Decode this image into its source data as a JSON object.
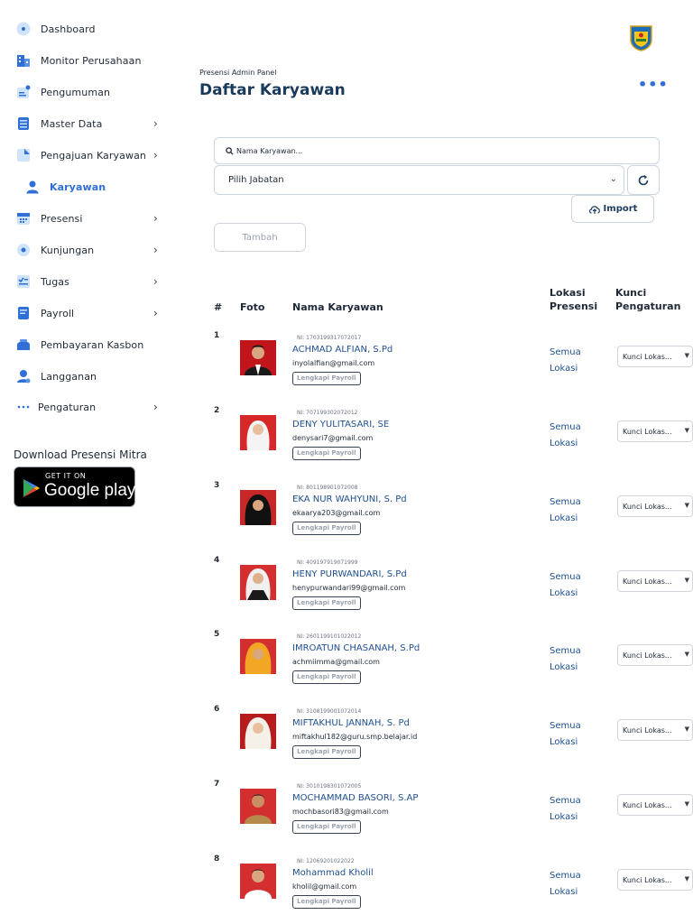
{
  "sidebar": {
    "items": [
      {
        "label": "Dashboard",
        "icon": "home-icon",
        "chevron": ""
      },
      {
        "label": "Monitor Perusahaan",
        "icon": "building-icon",
        "chevron": ""
      },
      {
        "label": "Pengumuman",
        "icon": "announcement-icon",
        "chevron": ""
      },
      {
        "label": "Master Data",
        "icon": "database-icon",
        "chevron": "›"
      },
      {
        "label": "Pengajuan Karyawan",
        "icon": "document-icon",
        "chevron": "›"
      },
      {
        "label": "Karyawan",
        "icon": "user-icon",
        "chevron": ""
      },
      {
        "label": "Presensi",
        "icon": "calendar-icon",
        "chevron": "›"
      },
      {
        "label": "Kunjungan",
        "icon": "location-icon",
        "chevron": "›"
      },
      {
        "label": "Tugas",
        "icon": "task-icon",
        "chevron": "›"
      },
      {
        "label": "Payroll",
        "icon": "payroll-icon",
        "chevron": "›"
      },
      {
        "label": "Pembayaran Kasbon",
        "icon": "wallet-icon",
        "chevron": ""
      },
      {
        "label": "Langganan",
        "icon": "subscription-icon",
        "chevron": ""
      },
      {
        "label": "Pengaturan",
        "icon": "more-dots-icon",
        "chevron": "›"
      }
    ],
    "download_title": "Download Presensi Mitra",
    "gplay_top": "GET IT ON",
    "gplay_bottom": "Google play"
  },
  "header": {
    "breadcrumb": "Presensi Admin Panel",
    "title": "Daftar Karyawan",
    "more": "•••"
  },
  "filters": {
    "search_placeholder": "Nama Karyawan...",
    "jabatan_selected": "Pilih Jabatan",
    "import_label": "Import",
    "tambah_label": "Tambah"
  },
  "table": {
    "headers": {
      "num": "#",
      "foto": "Foto",
      "nama": "Nama Karyawan",
      "lokasi_1": "Lokasi",
      "lokasi_2": "Presensi",
      "kunci_1": "Kunci",
      "kunci_2": "Pengaturan"
    },
    "rows": [
      {
        "num": "1",
        "nip": "NI: 1703199317072017",
        "name": "ACHMAD ALFIAN, S.Pd",
        "email": "inyolalfian@gmail.com",
        "badge": "Lengkapi Payroll",
        "lok1": "Semua",
        "lok2": "Lokasi",
        "kunci": "Kunci Lokas..."
      },
      {
        "num": "2",
        "nip": "NI: 707199302072012",
        "name": "DENY YULITASARI, SE",
        "email": "denysari7@gmail.com",
        "badge": "Lengkapi Payroll",
        "lok1": "Semua",
        "lok2": "Lokasi",
        "kunci": "Kunci Lokas..."
      },
      {
        "num": "3",
        "nip": "NI: 801198901072008",
        "name": "EKA NUR WAHYUNI, S. Pd",
        "email": "ekaarya203@gmail.com",
        "badge": "Lengkapi Payroll",
        "lok1": "Semua",
        "lok2": "Lokasi",
        "kunci": "Kunci Lokas..."
      },
      {
        "num": "4",
        "nip": "NI: 409197919071999",
        "name": "HENY PURWANDARI, S.Pd",
        "email": "henypurwandari99@gmail.com",
        "badge": "Lengkapi Payroll",
        "lok1": "Semua",
        "lok2": "Lokasi",
        "kunci": "Kunci Lokas..."
      },
      {
        "num": "5",
        "nip": "NI: 2601199101022012",
        "name": "IMROATUN CHASANAH, S.Pd",
        "email": "achmiimma@gmail.com",
        "badge": "Lengkapi Payroll",
        "lok1": "Semua",
        "lok2": "Lokasi",
        "kunci": "Kunci Lokas..."
      },
      {
        "num": "6",
        "nip": "NI: 3108199001072014",
        "name": "MIFTAKHUL JANNAH, S. Pd",
        "email": "miftakhul182@guru.smp.belajar.id",
        "badge": "Lengkapi Payroll",
        "lok1": "Semua",
        "lok2": "Lokasi",
        "kunci": "Kunci Lokas..."
      },
      {
        "num": "7",
        "nip": "NI: 3010198301072005",
        "name": "MOCHAMMAD BASORI, S.AP",
        "email": "mochbasori83@gmail.com",
        "badge": "Lengkapi Payroll",
        "lok1": "Semua",
        "lok2": "Lokasi",
        "kunci": "Kunci Lokas..."
      },
      {
        "num": "8",
        "nip": "NI: 12069201022022",
        "name": "Mohammad Kholil",
        "email": "kholil@gmail.com",
        "badge": "Lengkapi Payroll",
        "lok1": "Semua",
        "lok2": "Lokasi",
        "kunci": "Kunci Lokas..."
      }
    ]
  },
  "colors": {
    "accent": "#2f6fd6",
    "title": "#1a3a5c",
    "link": "#1e4f8f"
  }
}
